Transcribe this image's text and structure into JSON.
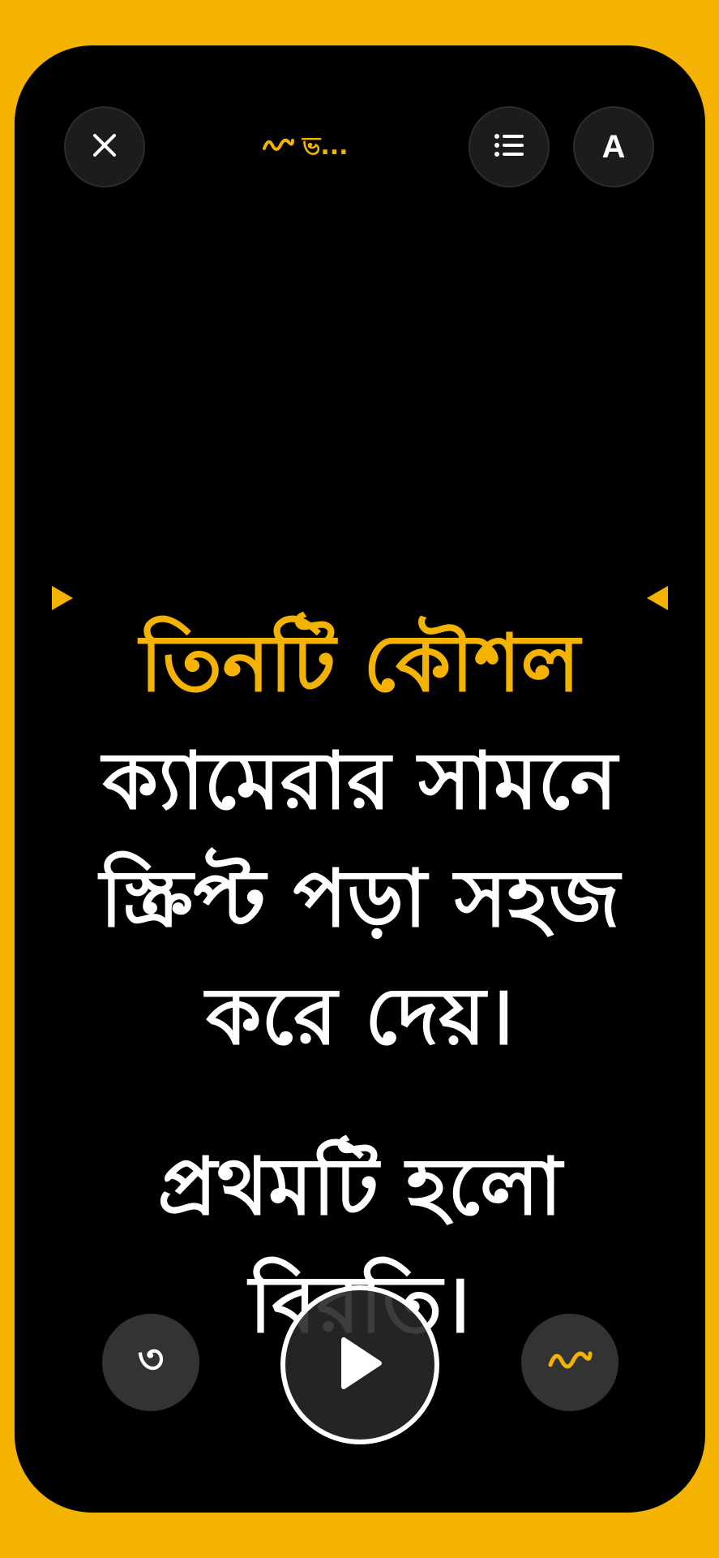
{
  "header": {
    "close_icon": "close-icon",
    "title": "ভ...",
    "title_icon": "wave-icon",
    "list_icon": "list-icon",
    "font_label": "A"
  },
  "script": {
    "highlight": "তিনটি কৌশল",
    "body": "ক্যামেরার সামনে স্ক্রিপ্ট পড়া সহজ করে দেয়।",
    "next": "প্রথমটি হলো বিরতি।"
  },
  "controls": {
    "rewind_label": "৩",
    "play_icon": "play-icon",
    "wave_icon": "wave-icon"
  },
  "colors": {
    "accent": "#f5b301",
    "background": "#000000",
    "text": "#ffffff"
  }
}
